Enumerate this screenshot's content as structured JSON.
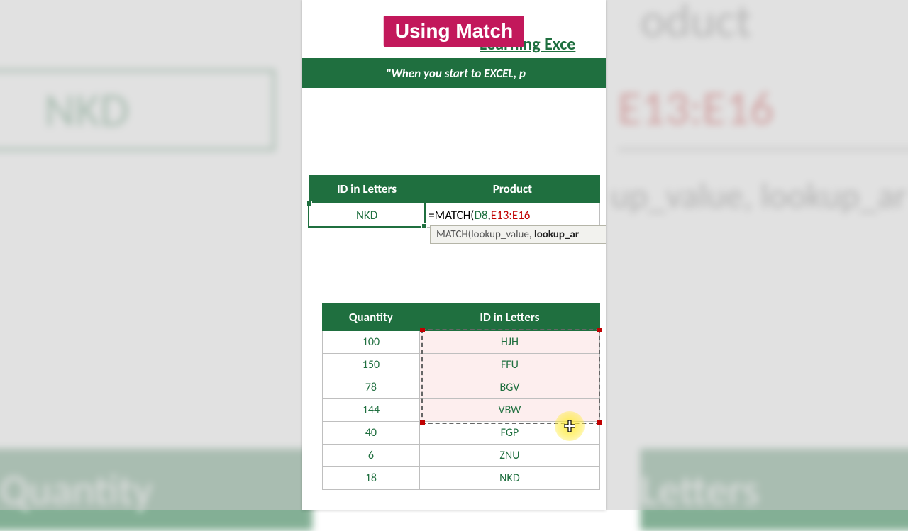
{
  "badge": "Using Match",
  "bg": {
    "top_cell": "NKD",
    "top_formula": "E13:E16",
    "top_header": "oduct",
    "mid_hint": "up_value, lookup_ar",
    "bot_header_left": "Quantity",
    "bot_header_right": "Letters"
  },
  "title_link": "Learning Exce",
  "green_bar": "\"When you start to EXCEL, p",
  "lookup_headers": {
    "col1": "ID in Letters",
    "col2": "Product"
  },
  "lookup_value": "NKD",
  "formula": {
    "prefix": "=MATCH(",
    "ref1": "D8",
    "sep": ",",
    "ref2": "E13:E16"
  },
  "tooltip": {
    "fn": "MATCH(",
    "arg1": "lookup_value",
    "sep": ", ",
    "arg2_bold": "lookup_ar"
  },
  "data_headers": {
    "col1": "Quantity",
    "col2": "ID in Letters"
  },
  "data_rows": [
    {
      "qty": "100",
      "id": "HJH",
      "selected": true
    },
    {
      "qty": "150",
      "id": "FFU",
      "selected": true
    },
    {
      "qty": "78",
      "id": "BGV",
      "selected": true
    },
    {
      "qty": "144",
      "id": "VBW",
      "selected": true
    },
    {
      "qty": "40",
      "id": "FGP",
      "selected": false
    },
    {
      "qty": "6",
      "id": "ZNU",
      "selected": false
    },
    {
      "qty": "18",
      "id": "NKD",
      "selected": false
    }
  ]
}
